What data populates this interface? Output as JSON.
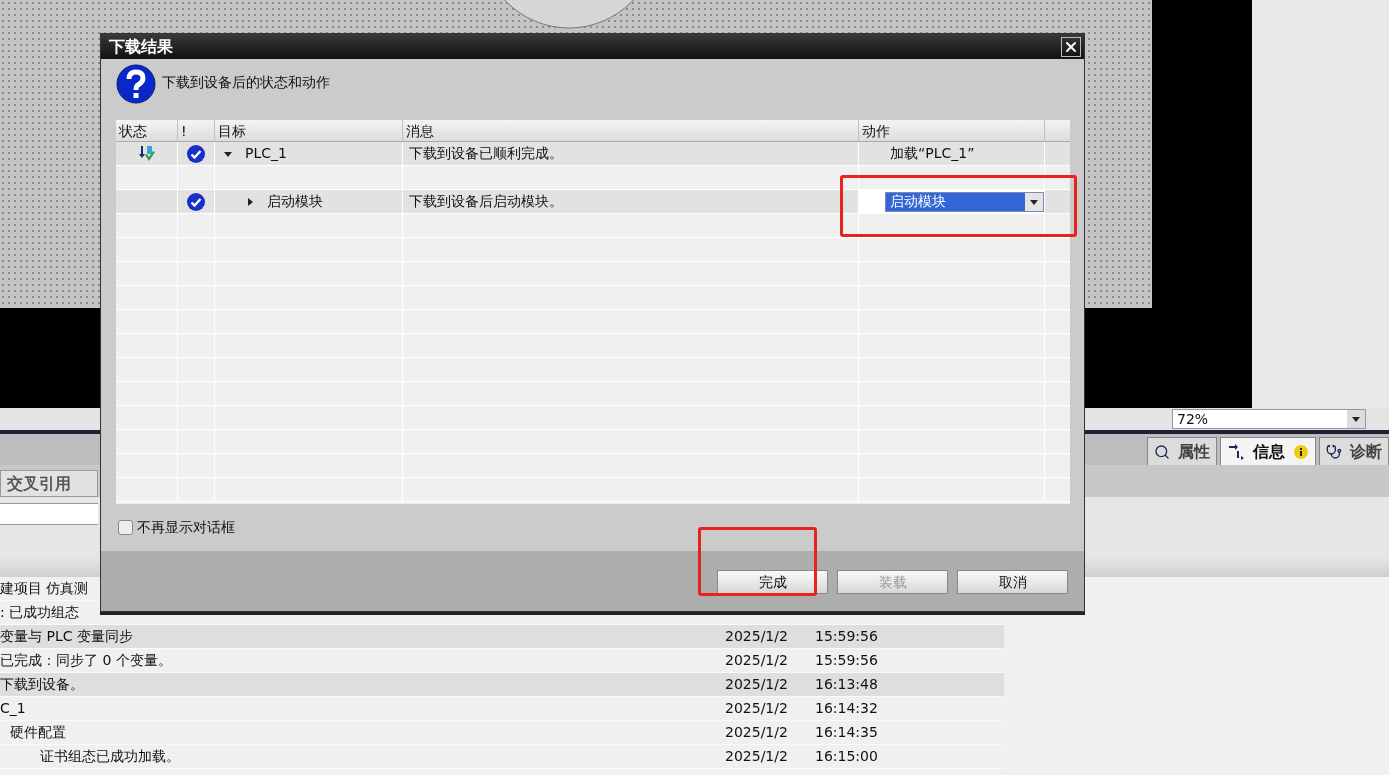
{
  "background": {
    "zoom": {
      "value": "72%"
    },
    "panel_tabs": [
      {
        "label": "属性",
        "selected": false,
        "badge": false
      },
      {
        "label": "信息",
        "selected": true,
        "badge": true
      },
      {
        "label": "诊断",
        "selected": false,
        "badge": false
      }
    ],
    "left_tab": {
      "label": "交叉引用"
    },
    "log_rows": [
      {
        "message": "建项目 仿真测",
        "highlighted": false
      },
      {
        "message": ": 已成功组态",
        "highlighted": false
      },
      {
        "message": "变量与 PLC 变量同步",
        "date": "2025/1/2",
        "time": "15:59:56",
        "highlighted": true
      },
      {
        "message": "已完成：同步了 0 个变量。",
        "date": "2025/1/2",
        "time": "15:59:56",
        "highlighted": false
      },
      {
        "message": "下载到设备。",
        "date": "2025/1/2",
        "time": "16:13:48",
        "highlighted": true
      },
      {
        "message": "C_1",
        "date": "2025/1/2",
        "time": "16:14:32",
        "highlighted": false,
        "children": [
          {
            "message": "硬件配置",
            "date": "2025/1/2",
            "time": "16:14:35",
            "children": [
              {
                "message": "证书组态已成功加载。",
                "date": "2025/1/2",
                "time": "16:15:00"
              }
            ]
          }
        ]
      }
    ]
  },
  "dialog": {
    "title": "下载结果",
    "question": "下载到设备后的状态和动作",
    "columns": [
      "状态",
      "!",
      "目标",
      "消息",
      "动作"
    ],
    "rows": [
      {
        "kind": "device",
        "downloaded": true,
        "ok": true,
        "expanded": true,
        "target": "PLC_1",
        "message": "下载到设备已顺利完成。",
        "action": {
          "kind": "text",
          "text": "加载“PLC_1”"
        }
      },
      {
        "kind": "blank"
      },
      {
        "kind": "module",
        "downloaded": false,
        "ok": true,
        "expanded": false,
        "target": "启动模块",
        "message": "下载到设备后启动模块。",
        "action": {
          "kind": "dropdown",
          "value": "启动模块"
        }
      }
    ],
    "dont_show_again": {
      "label": "不再显示对话框",
      "checked": false
    },
    "buttons": [
      {
        "label": "完成",
        "disabled": false
      },
      {
        "label": "装载",
        "disabled": true
      },
      {
        "label": "取消",
        "disabled": false
      }
    ]
  }
}
